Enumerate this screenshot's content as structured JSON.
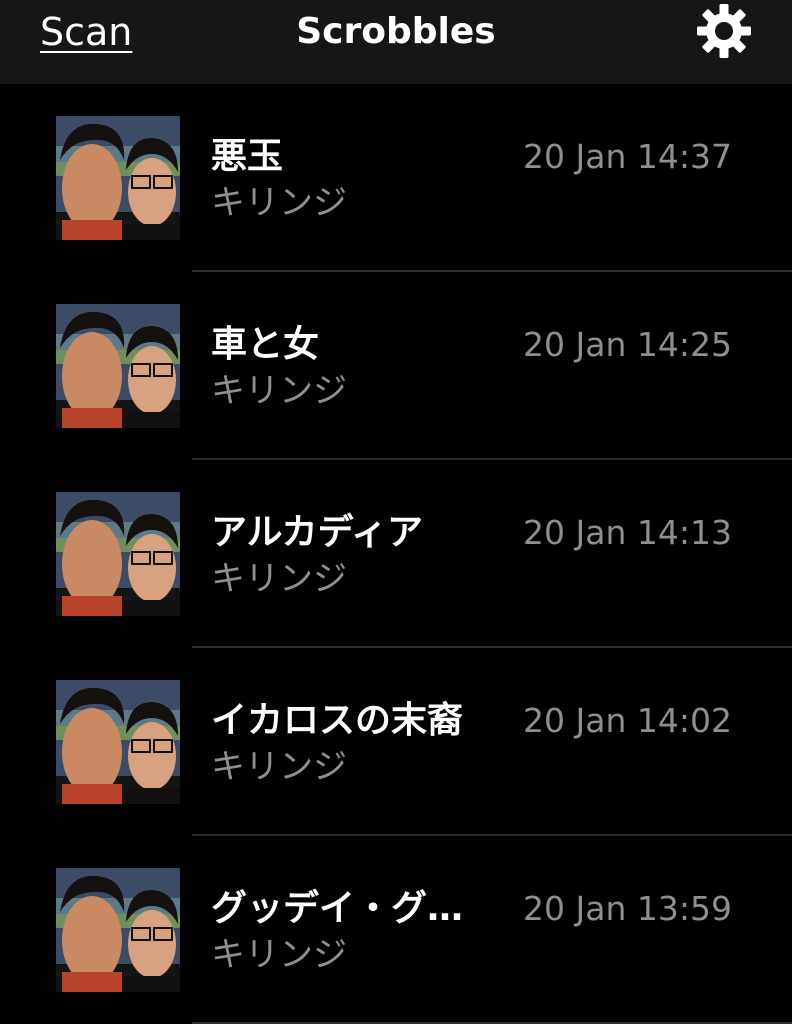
{
  "nav": {
    "scan_label": "Scan",
    "title": "Scrobbles",
    "settings_icon": "gear-icon"
  },
  "colors": {
    "background": "#000000",
    "nav_background": "#161616",
    "primary_text": "#ffffff",
    "secondary_text": "#8e8e93",
    "separator": "#2c2c2e"
  },
  "scrobbles": [
    {
      "title": "悪玉",
      "artist": "キリンジ",
      "time": "20 Jan 14:37",
      "artwork_icon": "album-art-image"
    },
    {
      "title": "車と女",
      "artist": "キリンジ",
      "time": "20 Jan 14:25",
      "artwork_icon": "album-art-image"
    },
    {
      "title": "アルカディア",
      "artist": "キリンジ",
      "time": "20 Jan 14:13",
      "artwork_icon": "album-art-image"
    },
    {
      "title": "イカロスの末裔",
      "artist": "キリンジ",
      "time": "20 Jan 14:02",
      "artwork_icon": "album-art-image"
    },
    {
      "title": "グッデイ・グ…",
      "artist": "キリンジ",
      "time": "20 Jan 13:59",
      "artwork_icon": "album-art-image"
    }
  ]
}
